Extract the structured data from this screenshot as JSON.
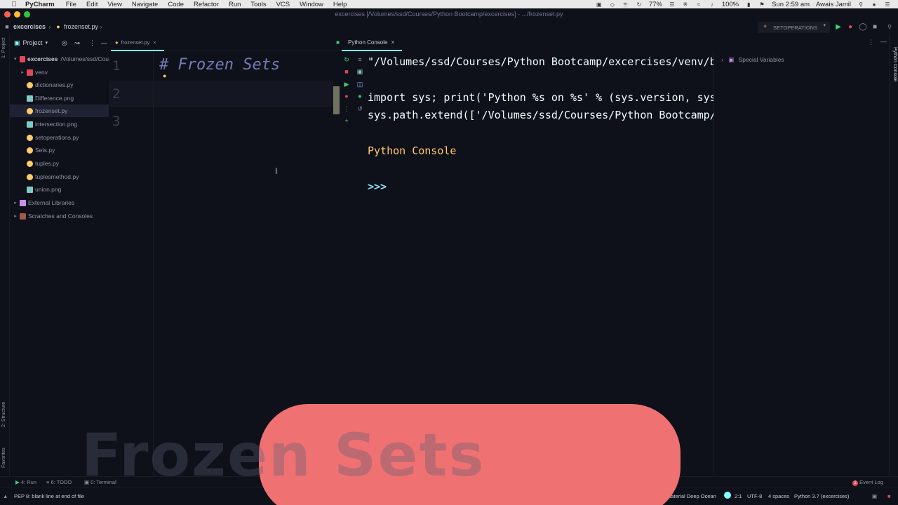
{
  "menubar": {
    "app_name": "PyCharm",
    "items": [
      "File",
      "Edit",
      "View",
      "Navigate",
      "Code",
      "Refactor",
      "Run",
      "Tools",
      "VCS",
      "Window",
      "Help"
    ],
    "battery_percent_cpu": "77%",
    "battery_percent": "100%",
    "clock": "Sun 2:59 am",
    "user": "Awais Jamil"
  },
  "window": {
    "title": "excercises [/Volumes/ssd/Courses/Python Bootcamp/excercises] - .../frozenset.py"
  },
  "navbar": {
    "project": "excercises",
    "file": "frozenset.py",
    "run_config": "SETOPERATIONS"
  },
  "project_panel": {
    "header": "Project",
    "root_name": "excercises",
    "root_path": "/Volumes/ssd/Cou",
    "items": [
      {
        "label": "venv",
        "kind": "folder"
      },
      {
        "label": "dictionaries.py",
        "kind": "py"
      },
      {
        "label": "Difference.png",
        "kind": "png"
      },
      {
        "label": "frozenset.py",
        "kind": "py"
      },
      {
        "label": "intersection.png",
        "kind": "png"
      },
      {
        "label": "setoperations.py",
        "kind": "py"
      },
      {
        "label": "Sets.py",
        "kind": "py"
      },
      {
        "label": "tuples.py",
        "kind": "py"
      },
      {
        "label": "tuplesmethod.py",
        "kind": "py"
      },
      {
        "label": "union.png",
        "kind": "png"
      }
    ],
    "external": "External Libraries",
    "scratches": "Scratches and Consoles"
  },
  "stripe": {
    "project": "1: Project",
    "structure": "2: Structure",
    "favorites": "Favorites",
    "python_console": "Python Console"
  },
  "editor": {
    "tab": "frozenset.py",
    "line_numbers": [
      "1",
      "2",
      "3"
    ],
    "comment_hash": "#",
    "comment_text": "Frozen Sets"
  },
  "console": {
    "tab": "Python Console",
    "lines": [
      "\"/Volumes/ssd/Courses/Python Bootcamp/excercises/venv/bi",
      "import sys; print('Python %s on %s' % (sys.version, sys.",
      "sys.path.extend(['/Volumes/ssd/Courses/Python Bootcamp/e"
    ],
    "heading": "Python Console",
    "prompt": ">>>",
    "special_variables": "Special Variables"
  },
  "toolwindows": {
    "run": "4: Run",
    "todo": "6: TODO",
    "terminal": "0: Terminal",
    "event_log": "Event Log",
    "event_count": "2"
  },
  "statusbar": {
    "message": "PEP 8: blank line at end of file",
    "theme": "Material Deep Ocean",
    "position": "2:1",
    "encoding": "UTF-8",
    "indent": "4 spaces",
    "interpreter": "Python 3.7 (excercises)"
  },
  "overlay": {
    "title": "Frozen Sets"
  },
  "colors": {
    "background": "#0f111a",
    "accent": "#84ffff",
    "overlay": "#f07172",
    "comment": "#717cb4",
    "console_heading": "#ffcb6b",
    "prompt": "#89ddff"
  }
}
